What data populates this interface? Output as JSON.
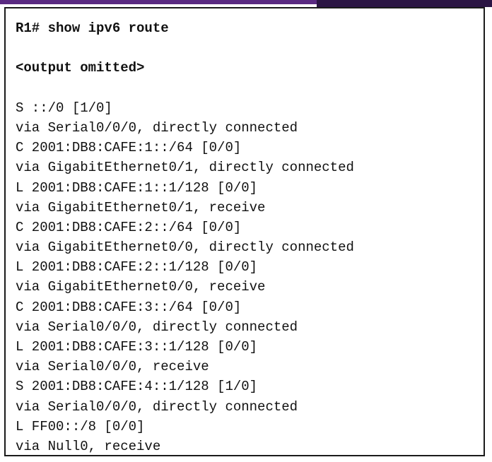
{
  "terminal": {
    "command": "R1# show ipv6 route",
    "omitted": "<output omitted>",
    "routes": [
      "S ::/0 [1/0]",
      "via Serial0/0/0, directly connected",
      "C 2001:DB8:CAFE:1::/64 [0/0]",
      "via GigabitEthernet0/1, directly connected",
      "L 2001:DB8:CAFE:1::1/128 [0/0]",
      "via GigabitEthernet0/1, receive",
      "C 2001:DB8:CAFE:2::/64 [0/0]",
      "via GigabitEthernet0/0, directly connected",
      "L 2001:DB8:CAFE:2::1/128 [0/0]",
      "via GigabitEthernet0/0, receive",
      "C 2001:DB8:CAFE:3::/64 [0/0]",
      "via Serial0/0/0, directly connected",
      "L 2001:DB8:CAFE:3::1/128 [0/0]",
      "via Serial0/0/0, receive",
      "S 2001:DB8:CAFE:4::1/128 [1/0]",
      "via Serial0/0/0, directly connected",
      "L FF00::/8 [0/0]",
      "via Null0, receive"
    ]
  },
  "colors": {
    "accent_bar": "#5a2a82",
    "accent_bar_dark": "#2b1544",
    "text": "#111111",
    "border": "#1a1a1a"
  }
}
